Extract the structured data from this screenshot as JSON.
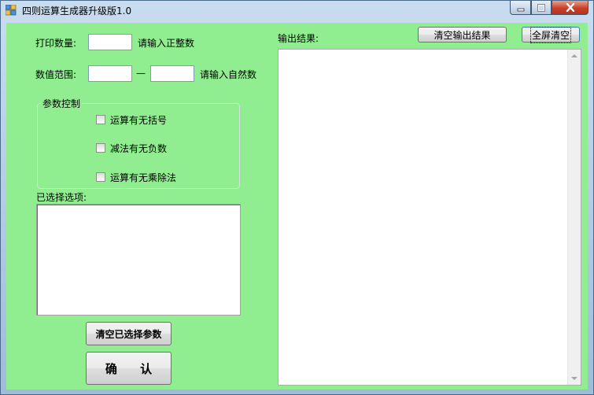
{
  "window": {
    "title": "四则运算生成器升级版1.0"
  },
  "form": {
    "print_count_label": "打印数量:",
    "print_count_value": "",
    "print_count_hint": "请输入正整数",
    "range_label": "数值范围:",
    "range_min_value": "",
    "range_separator": "—",
    "range_max_value": "",
    "range_hint": "请输入自然数"
  },
  "params": {
    "group_label": "参数控制",
    "options": [
      {
        "label": "运算有无括号",
        "checked": false
      },
      {
        "label": "减法有无负数",
        "checked": false
      },
      {
        "label": "运算有无乘除法",
        "checked": false
      }
    ]
  },
  "selected": {
    "label": "已选择选项:",
    "value": ""
  },
  "buttons": {
    "clear_params": "清空已选择参数",
    "confirm": "确 认",
    "clear_output": "清空输出结果",
    "clear_all": "全屏清空"
  },
  "output": {
    "label": "输出结果:",
    "value": ""
  },
  "colors": {
    "client_bg": "#90ee90"
  }
}
